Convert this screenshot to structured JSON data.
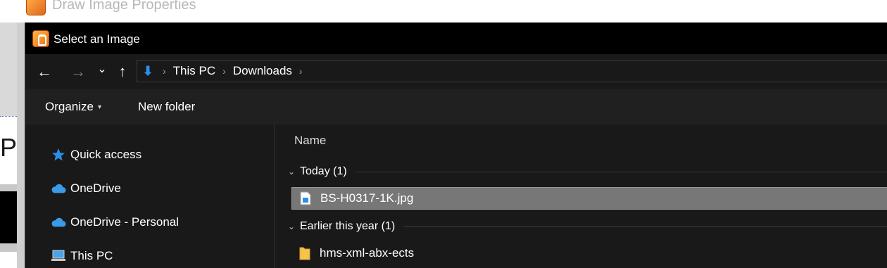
{
  "background_window": {
    "title": "Draw Image Properties",
    "partial_text": "Pl"
  },
  "dialog": {
    "title": "Select an Image"
  },
  "navbar": {
    "back_icon": "←",
    "forward_icon": "→",
    "recent_icon": "⌄",
    "up_icon": "↑",
    "download_icon": "⬇",
    "separator": "›",
    "breadcrumbs": [
      "This PC",
      "Downloads"
    ]
  },
  "toolbar": {
    "organize_label": "Organize",
    "organize_caret": "▾",
    "new_folder_label": "New folder"
  },
  "navpane": {
    "items": [
      {
        "label": "Quick access",
        "icon": "star-icon"
      },
      {
        "label": "OneDrive",
        "icon": "cloud-icon"
      },
      {
        "label": "OneDrive - Personal",
        "icon": "cloud-icon"
      },
      {
        "label": "This PC",
        "icon": "computer-icon"
      }
    ]
  },
  "content": {
    "column_header": "Name",
    "groups": [
      {
        "label": "Today (1)",
        "files": [
          {
            "name": "BS-H0317-1K.jpg",
            "icon": "image-file-icon",
            "selected": true
          }
        ]
      },
      {
        "label": "Earlier this year (1)",
        "files": [
          {
            "name": "hms-xml-abx-ects",
            "icon": "folder-icon",
            "selected": false
          }
        ]
      }
    ],
    "chevron": "⌄"
  },
  "colors": {
    "accent": "#2b8fe8",
    "dialog_bg": "#191919",
    "titlebar_bg": "#000000",
    "selection_bg": "#777777"
  }
}
